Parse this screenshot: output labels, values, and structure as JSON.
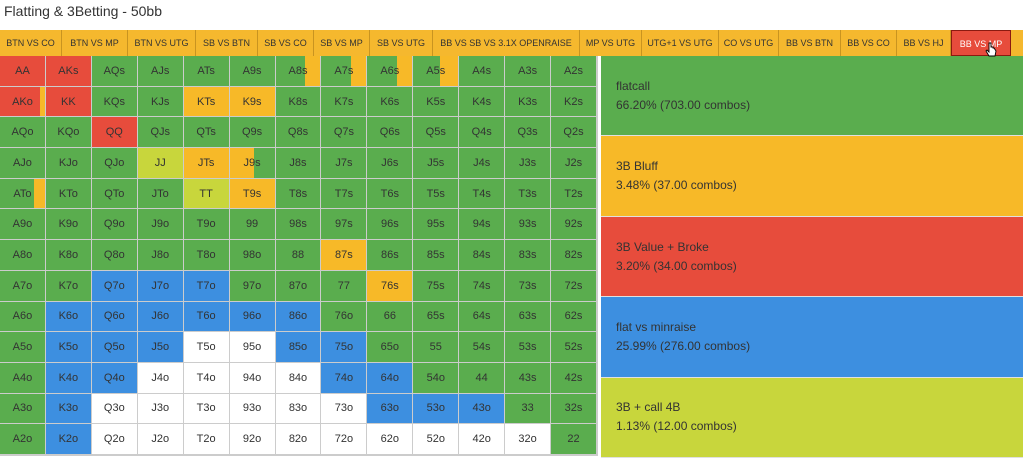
{
  "title": "Flatting & 3Betting - 50bb",
  "tabs": [
    {
      "label": "BTN VS CO",
      "active": false,
      "w": 62
    },
    {
      "label": "BTN VS MP",
      "active": false,
      "w": 66
    },
    {
      "label": "BTN VS UTG",
      "active": false,
      "w": 68
    },
    {
      "label": "SB VS BTN",
      "active": false,
      "w": 62
    },
    {
      "label": "SB VS CO",
      "active": false,
      "w": 56
    },
    {
      "label": "SB VS MP",
      "active": false,
      "w": 56
    },
    {
      "label": "SB VS UTG",
      "active": false,
      "w": 63
    },
    {
      "label": "BB VS SB VS 3.1X OPENRAISE",
      "active": false,
      "w": 147
    },
    {
      "label": "MP VS UTG",
      "active": false,
      "w": 62
    },
    {
      "label": "UTG+1 VS UTG",
      "active": false,
      "w": 77
    },
    {
      "label": "CO VS UTG",
      "active": false,
      "w": 60
    },
    {
      "label": "BB VS BTN",
      "active": false,
      "w": 62
    },
    {
      "label": "BB VS CO",
      "active": false,
      "w": 56
    },
    {
      "label": "BB VS HJ",
      "active": false,
      "w": 54
    },
    {
      "label": "BB VS MP",
      "active": true,
      "w": 60
    }
  ],
  "colors": {
    "green": "#5aad4e",
    "yellow": "#f7b928",
    "red": "#e74c3c",
    "blue": "#3d8fe0",
    "lime": "#c8d63c",
    "white": "#ffffff"
  },
  "hands": [
    [
      "AA",
      "AKs",
      "AQs",
      "AJs",
      "ATs",
      "A9s",
      "A8s",
      "A7s",
      "A6s",
      "A5s",
      "A4s",
      "A3s",
      "A2s"
    ],
    [
      "AKo",
      "KK",
      "KQs",
      "KJs",
      "KTs",
      "K9s",
      "K8s",
      "K7s",
      "K6s",
      "K5s",
      "K4s",
      "K3s",
      "K2s"
    ],
    [
      "AQo",
      "KQo",
      "QQ",
      "QJs",
      "QTs",
      "Q9s",
      "Q8s",
      "Q7s",
      "Q6s",
      "Q5s",
      "Q4s",
      "Q3s",
      "Q2s"
    ],
    [
      "AJo",
      "KJo",
      "QJo",
      "JJ",
      "JTs",
      "J9s",
      "J8s",
      "J7s",
      "J6s",
      "J5s",
      "J4s",
      "J3s",
      "J2s"
    ],
    [
      "ATo",
      "KTo",
      "QTo",
      "JTo",
      "TT",
      "T9s",
      "T8s",
      "T7s",
      "T6s",
      "T5s",
      "T4s",
      "T3s",
      "T2s"
    ],
    [
      "A9o",
      "K9o",
      "Q9o",
      "J9o",
      "T9o",
      "99",
      "98s",
      "97s",
      "96s",
      "95s",
      "94s",
      "93s",
      "92s"
    ],
    [
      "A8o",
      "K8o",
      "Q8o",
      "J8o",
      "T8o",
      "98o",
      "88",
      "87s",
      "86s",
      "85s",
      "84s",
      "83s",
      "82s"
    ],
    [
      "A7o",
      "K7o",
      "Q7o",
      "J7o",
      "T7o",
      "97o",
      "87o",
      "77",
      "76s",
      "75s",
      "74s",
      "73s",
      "72s"
    ],
    [
      "A6o",
      "K6o",
      "Q6o",
      "J6o",
      "T6o",
      "96o",
      "86o",
      "76o",
      "66",
      "65s",
      "64s",
      "63s",
      "62s"
    ],
    [
      "A5o",
      "K5o",
      "Q5o",
      "J5o",
      "T5o",
      "95o",
      "85o",
      "75o",
      "65o",
      "55",
      "54s",
      "53s",
      "52s"
    ],
    [
      "A4o",
      "K4o",
      "Q4o",
      "J4o",
      "T4o",
      "94o",
      "84o",
      "74o",
      "64o",
      "54o",
      "44",
      "43s",
      "42s"
    ],
    [
      "A3o",
      "K3o",
      "Q3o",
      "J3o",
      "T3o",
      "93o",
      "83o",
      "73o",
      "63o",
      "53o",
      "43o",
      "33",
      "32s"
    ],
    [
      "A2o",
      "K2o",
      "Q2o",
      "J2o",
      "T2o",
      "92o",
      "82o",
      "72o",
      "62o",
      "52o",
      "42o",
      "32o",
      "22"
    ]
  ],
  "cell_colors": [
    [
      "red",
      "red",
      "green",
      "green",
      "green",
      "green",
      "green",
      "green",
      "green",
      "green",
      "green",
      "green",
      "green"
    ],
    [
      "red",
      "red",
      "green",
      "green",
      "yellow",
      "yellow",
      "green",
      "green",
      "green",
      "green",
      "green",
      "green",
      "green"
    ],
    [
      "green",
      "green",
      "red",
      "green",
      "green",
      "green",
      "green",
      "green",
      "green",
      "green",
      "green",
      "green",
      "green"
    ],
    [
      "green",
      "green",
      "green",
      "lime",
      "yellow",
      "green",
      "green",
      "green",
      "green",
      "green",
      "green",
      "green",
      "green"
    ],
    [
      "green",
      "green",
      "green",
      "green",
      "lime",
      "yellow",
      "green",
      "green",
      "green",
      "green",
      "green",
      "green",
      "green"
    ],
    [
      "green",
      "green",
      "green",
      "green",
      "green",
      "green",
      "green",
      "green",
      "green",
      "green",
      "green",
      "green",
      "green"
    ],
    [
      "green",
      "green",
      "green",
      "green",
      "green",
      "green",
      "green",
      "yellow",
      "green",
      "green",
      "green",
      "green",
      "green"
    ],
    [
      "green",
      "green",
      "blue",
      "blue",
      "blue",
      "green",
      "green",
      "green",
      "yellow",
      "green",
      "green",
      "green",
      "green"
    ],
    [
      "green",
      "blue",
      "blue",
      "blue",
      "blue",
      "blue",
      "blue",
      "green",
      "green",
      "green",
      "green",
      "green",
      "green"
    ],
    [
      "green",
      "blue",
      "blue",
      "blue",
      "white",
      "white",
      "blue",
      "blue",
      "green",
      "green",
      "green",
      "green",
      "green"
    ],
    [
      "green",
      "blue",
      "blue",
      "white",
      "white",
      "white",
      "white",
      "blue",
      "blue",
      "green",
      "green",
      "green",
      "green"
    ],
    [
      "green",
      "blue",
      "white",
      "white",
      "white",
      "white",
      "white",
      "white",
      "blue",
      "blue",
      "blue",
      "green",
      "green"
    ],
    [
      "green",
      "blue",
      "white",
      "white",
      "white",
      "white",
      "white",
      "white",
      "white",
      "white",
      "white",
      "white",
      "green"
    ]
  ],
  "mixed_cells": [
    {
      "r": 0,
      "c": 6,
      "color": "yellow",
      "frac": 0.35,
      "side": "right"
    },
    {
      "r": 0,
      "c": 7,
      "color": "yellow",
      "frac": 0.35,
      "side": "right"
    },
    {
      "r": 0,
      "c": 8,
      "color": "yellow",
      "frac": 0.35,
      "side": "right"
    },
    {
      "r": 0,
      "c": 9,
      "color": "yellow",
      "frac": 0.4,
      "side": "right"
    },
    {
      "r": 1,
      "c": 0,
      "color": "yellow",
      "frac": 0.12,
      "side": "right"
    },
    {
      "r": 3,
      "c": 5,
      "color": "yellow",
      "frac": 0.55,
      "side": "left"
    },
    {
      "r": 4,
      "c": 0,
      "color": "yellow",
      "frac": 0.25,
      "side": "right"
    }
  ],
  "legend": [
    {
      "name": "flatcall",
      "detail": "66.20% (703.00 combos)",
      "color": "green"
    },
    {
      "name": "3B Bluff",
      "detail": "3.48% (37.00 combos)",
      "color": "yellow"
    },
    {
      "name": "3B Value + Broke",
      "detail": "3.20% (34.00 combos)",
      "color": "red"
    },
    {
      "name": "flat vs minraise",
      "detail": "25.99% (276.00 combos)",
      "color": "blue"
    },
    {
      "name": "3B + call 4B",
      "detail": "1.13% (12.00 combos)",
      "color": "lime"
    }
  ]
}
